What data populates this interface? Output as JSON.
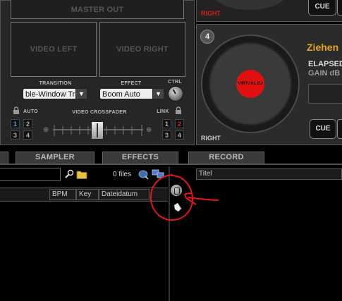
{
  "video": {
    "master_out_label": "MASTER OUT",
    "left_label": "VIDEO LEFT",
    "right_label": "VIDEO RIGHT",
    "transition_label": "TRANSITION",
    "transition_value": "ble-Window Tr",
    "effect_label": "EFFECT",
    "effect_value": "Boom Auto",
    "ctrl_label": "CTRL",
    "auto_label": "AUTO",
    "crossfader_label": "VIDEO CROSSFADER",
    "link_label": "LINK",
    "left_buttons": [
      "1",
      "2",
      "3",
      "4"
    ],
    "right_buttons": [
      "1",
      "2",
      "3",
      "4"
    ]
  },
  "deck_top": {
    "side_label": "RIGHT",
    "cue_label": "CUE"
  },
  "deck4": {
    "number": "4",
    "logo_text": "VIRTUAL DJ",
    "side_label": "RIGHT",
    "title_text": "Ziehen",
    "elapsed_label": "ELAPSED",
    "gain_label": "GAIN dB",
    "cue_label": "CUE"
  },
  "tabs": [
    "SAMPLER",
    "EFFECTS",
    "RECORD"
  ],
  "browser": {
    "search_value": "",
    "files_count": "0 files",
    "left_columns": [
      "BPM",
      "Key",
      "Dateidatum"
    ],
    "right_column": "Titel"
  },
  "colors": {
    "accent_orange": "#e8a317",
    "right_label_red": "#d22020",
    "annotation_red": "#e01818",
    "logo_red": "#e01010"
  }
}
